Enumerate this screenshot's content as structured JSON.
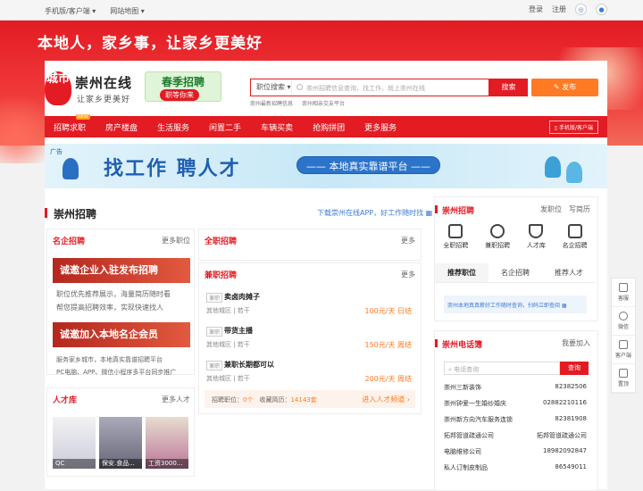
{
  "topbar": {
    "mobile": "手机版/客户端",
    "sitemap": "网站地图",
    "login": "登录",
    "register": "注册"
  },
  "banner": {
    "slogan": "本地人，家乡事，让家乡更美好"
  },
  "logo": {
    "badge": "城市",
    "name": "崇州在线",
    "tagline": "让家乡更美好"
  },
  "spring": {
    "title": "春季招聘",
    "sub": "职等你来"
  },
  "search": {
    "select": "职位搜索",
    "placeholder": "崇州招聘信息查询，找工作，就上崇州在线",
    "button": "搜索",
    "publish": "发布"
  },
  "hot_links": [
    "崇州最新招聘信息",
    "崇州相亲交友平台"
  ],
  "nav": {
    "items": [
      "招聘求职",
      "房产楼盘",
      "生活服务",
      "闲置二手",
      "车辆买卖",
      "抢购拼团",
      "更多服务"
    ],
    "new_badge": "NEW",
    "mobile": "手机版/客户端"
  },
  "ad": {
    "corner": "广告",
    "title": "找工作  聘人才",
    "tagline": "—— 本地真实靠谱平台 ——"
  },
  "section": {
    "title": "崇州招聘",
    "download": "下载崇州在线APP，好工作随时找"
  },
  "famous": {
    "label": "名企招聘",
    "more": "更多职位",
    "promo1": "诚邀企业入驻发布招聘",
    "desc1a": "职位优先推荐展示，海量简历随时看",
    "desc1b": "帮您提高招聘效率，实现快速找人",
    "promo2": "诚邀加入本地名企会员",
    "desc2a": "服务家乡城市，本地真实靠谱招聘平台",
    "desc2b": "PC电脑、APP、微信小程序多平台同步推广"
  },
  "full": {
    "label": "全职招聘",
    "more": "更多"
  },
  "part": {
    "label": "兼职招聘",
    "more": "更多",
    "tag": "兼职",
    "jobs": [
      {
        "name": "卖卤肉摊子",
        "sub": "其他城区 | 若干",
        "pay": "100元/天",
        "cycle": "日结"
      },
      {
        "name": "带货主播",
        "sub": "其他城区 | 若干",
        "pay": "150元/天",
        "cycle": "周结"
      },
      {
        "name": "兼职长期都可以",
        "sub": "其他城区 | 若干",
        "pay": "200元/天",
        "cycle": "周结"
      }
    ]
  },
  "stats": {
    "jobs_label": "招聘职位：",
    "jobs": "0个",
    "resumes_label": "收藏简历：",
    "resumes": "14143套",
    "enter": "进入人才频道"
  },
  "talent": {
    "label": "人才库",
    "more": "更多人才",
    "people": [
      "QC",
      "保安.食品...",
      "工资3000..."
    ]
  },
  "right_job": {
    "title": "崇州招聘",
    "find": "发职位",
    "write": "写简历",
    "icons": [
      "全职招聘",
      "兼职招聘",
      "人才库",
      "名企招聘"
    ],
    "tabs": [
      "推荐职位",
      "名企招聘",
      "推荐人才"
    ],
    "notice": "崇州本地真真薪好工作随时查询，扫码立即查阅"
  },
  "phonebook": {
    "title": "崇州电话簿",
    "join": "我要加入",
    "placeholder": "电话查询",
    "button": "查询",
    "rows": [
      [
        "崇州三新装饰",
        "82382506"
      ],
      [
        "崇州钟爱一生婚纱婚庆",
        "02882210116"
      ],
      [
        "崇州新方向汽车服务连锁",
        "82381908"
      ],
      [
        "拓邦管道疏通公司",
        "拓邦管道疏通公司"
      ],
      [
        "电脑维修公司",
        "18982092847"
      ],
      [
        "私人订制皮制品",
        "86549011"
      ]
    ]
  },
  "float": [
    "客服",
    "微信",
    "客户端",
    "置顶"
  ]
}
